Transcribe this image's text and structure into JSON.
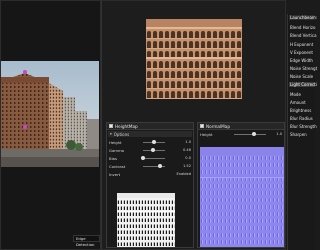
{
  "input": {
    "status_label": "Edge Detection"
  },
  "heightmap_node": {
    "title": "HeightMap",
    "options_label": "Options",
    "params": [
      {
        "label": "Height",
        "value": "1.0",
        "level": 0.5
      },
      {
        "label": "Gamma",
        "value": "0.46",
        "level": 0.46
      },
      {
        "label": "Bias",
        "value": "0.0",
        "level": 0.0
      },
      {
        "label": "Contrast",
        "value": "1.52",
        "level": 0.76
      },
      {
        "label": "Invert",
        "value": "Enabled"
      }
    ]
  },
  "normalmap_node": {
    "title": "NormalMap",
    "params": [
      {
        "label": "Height",
        "value": "1.0",
        "level": 0.62
      }
    ]
  },
  "prop_list": {
    "items": [
      "Launchbeam:",
      "Blend Horizo",
      "Blend Vertica",
      "H Exponent",
      "V Exponent",
      "Edge Width",
      "Noise Strengt",
      "Noise Scale",
      "Light Correcti",
      "Mode",
      "Amount",
      "Brightness",
      "Blur Radius",
      "Blur Strength",
      "Sharpen"
    ]
  },
  "colors": {
    "normal_map": "#8c86ee",
    "accent": "#cc44cc"
  }
}
